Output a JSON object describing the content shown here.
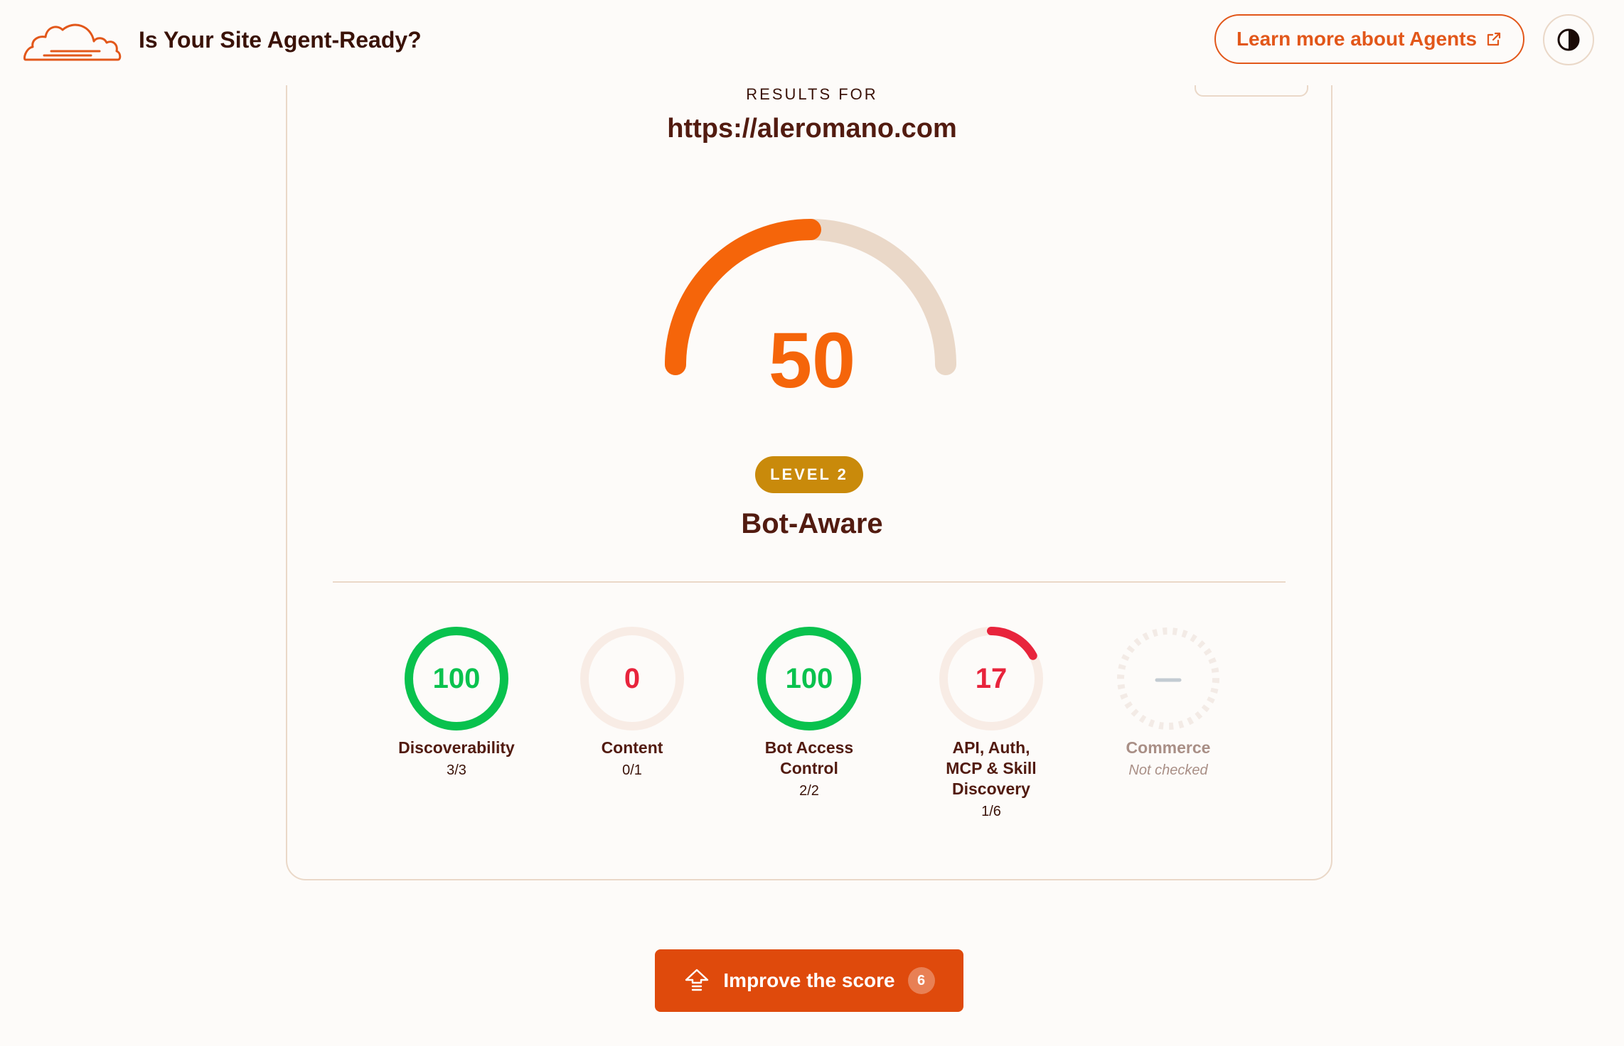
{
  "header": {
    "title": "Is Your Site Agent-Ready?",
    "learn_more_label": "Learn more about Agents"
  },
  "icons": {
    "logo": "cloud-logo-icon",
    "external_link": "external-link-icon",
    "theme_toggle": "contrast-icon",
    "improve": "upgrade-arrow-icon"
  },
  "colors": {
    "accent": "#f5650a",
    "brand_orange": "#e2571a",
    "cta": "#df4a0c",
    "pass_green": "#09c24e",
    "fail_red": "#e8243c",
    "level_badge": "#c98a0b",
    "track": "#ead8c8",
    "text_dark": "#521b10"
  },
  "results": {
    "label": "RESULTS FOR",
    "url": "https://aleromano.com"
  },
  "score": {
    "value": "50",
    "max": 100,
    "level_label": "LEVEL 2",
    "level_name": "Bot-Aware"
  },
  "categories": [
    {
      "label": "Discoverability",
      "value": "100",
      "percent": 100,
      "score": "3/3",
      "status": "pass"
    },
    {
      "label": "Content",
      "value": "0",
      "percent": 0,
      "score": "0/1",
      "status": "fail"
    },
    {
      "label": "Bot Access Control",
      "value": "100",
      "percent": 100,
      "score": "2/2",
      "status": "pass"
    },
    {
      "label": "API, Auth, MCP & Skill Discovery",
      "value": "17",
      "percent": 17,
      "score": "1/6",
      "status": "fail"
    },
    {
      "label": "Commerce",
      "value": "—",
      "percent": null,
      "score": "Not checked",
      "status": "unchecked"
    }
  ],
  "cta": {
    "label": "Improve the score",
    "count": "6"
  }
}
